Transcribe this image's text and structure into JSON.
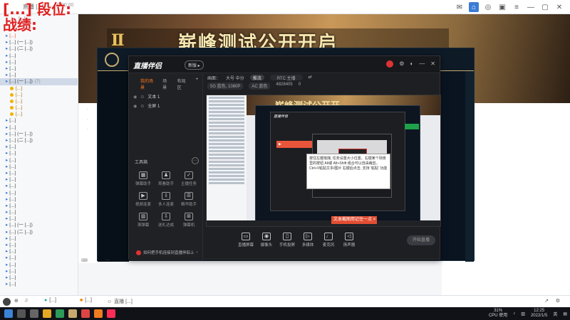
{
  "overlay": {
    "line1": "[...] 段位:",
    "line2": "战绩:"
  },
  "topbar": {
    "title": "直播 [...]",
    "time": "0:00:00"
  },
  "left_list": {
    "header": "[...]",
    "items": [
      {
        "label": "[...]",
        "count": "",
        "type": "red"
      },
      {
        "label": "[...] (一 [...])",
        "count": "",
        "type": "normal"
      },
      {
        "label": "[...] (二 [...])",
        "count": "",
        "type": "normal"
      },
      {
        "label": "[...]",
        "count": "",
        "type": "normal"
      },
      {
        "label": "[...]",
        "count": "",
        "type": "normal"
      },
      {
        "label": "[...]",
        "count": "",
        "type": "normal"
      },
      {
        "label": "[...]",
        "count": "",
        "type": "normal"
      },
      {
        "label": "[...] (一 [...])",
        "count": "(7)",
        "type": "sel"
      },
      {
        "label": "[...]",
        "count": "",
        "type": "sub"
      },
      {
        "label": "[...]",
        "count": "",
        "type": "sub"
      },
      {
        "label": "[...]",
        "count": "",
        "type": "sub"
      },
      {
        "label": "[...]",
        "count": "",
        "type": "sub"
      },
      {
        "label": "[...]",
        "count": "",
        "type": "sub"
      },
      {
        "label": "[...]",
        "count": "",
        "type": "normal"
      },
      {
        "label": "[...]",
        "count": "",
        "type": "normal"
      },
      {
        "label": "[...] (一 [...])",
        "count": "",
        "type": "normal"
      },
      {
        "label": "[...] (二 [...])",
        "count": "",
        "type": "normal"
      },
      {
        "label": "[...]",
        "count": "",
        "type": "normal"
      },
      {
        "label": "[...]",
        "count": "",
        "type": "normal"
      },
      {
        "label": "[...]",
        "count": "",
        "type": "normal"
      },
      {
        "label": "[...]",
        "count": "",
        "type": "normal"
      },
      {
        "label": "[...]",
        "count": "",
        "type": "normal"
      },
      {
        "label": "[...]",
        "count": "",
        "type": "normal"
      },
      {
        "label": "[...]",
        "count": "",
        "type": "normal"
      },
      {
        "label": "[...]",
        "count": "",
        "type": "normal"
      },
      {
        "label": "[...]",
        "count": "",
        "type": "normal"
      },
      {
        "label": "[...]",
        "count": "",
        "type": "normal"
      },
      {
        "label": "[...]",
        "count": "",
        "type": "normal"
      },
      {
        "label": "[...]",
        "count": "",
        "type": "normal"
      },
      {
        "label": "[...] (一 [...])",
        "count": "",
        "type": "normal"
      },
      {
        "label": "[...] (二 [...])",
        "count": "",
        "type": "normal"
      },
      {
        "label": "[...]",
        "count": "",
        "type": "normal"
      },
      {
        "label": "[...]",
        "count": "",
        "type": "normal"
      },
      {
        "label": "[...]",
        "count": "",
        "type": "normal"
      },
      {
        "label": "[...]",
        "count": "",
        "type": "normal"
      },
      {
        "label": "[...]",
        "count": "",
        "type": "normal"
      },
      {
        "label": "[...]",
        "count": "",
        "type": "normal"
      },
      {
        "label": "[...]",
        "count": "",
        "type": "normal"
      },
      {
        "label": "[...]",
        "count": "",
        "type": "normal"
      }
    ]
  },
  "banner": {
    "text": "崭峰测试公开开启"
  },
  "obs": {
    "brand": "直播伴侣",
    "tag": "新版 ▸",
    "tabs": [
      "我的场景",
      "场景",
      "布局区"
    ],
    "sources": [
      "文本 1",
      "全屏 1"
    ],
    "toolbox_title": "工具箱",
    "tools": [
      "弹幕助手",
      "观看助手",
      "主播任务",
      "视频连麦",
      "多人连麦",
      "精华助手",
      "滚弹幕",
      "送礼达成",
      "弹幕机"
    ],
    "option_text": "如何把手机连接到直播伴侣上",
    "bar1": [
      "画面：",
      "大号 中分",
      "推流",
      "RTC 主播",
      "⇄"
    ],
    "bar2": [
      "5G 蓝色, 1080P",
      "AC 蓝色",
      "4828405",
      "0"
    ],
    "preview_banner": "崭峰测试公开开",
    "red_hint": "文本截图用记住一点 ×",
    "tip": "按住左键拖拽, 任务设置大小位置。右键某个场景里的按钮 Alt或 Alt+Shift 组合可以自由裁剪。 Ctrl+V粘贴文本/图片 右键后点击, 支持 '粘贴' 功能",
    "controls": [
      "直播屏幕",
      "摄像头",
      "手机投屏",
      "多媒体",
      "麦克风",
      "扬声器"
    ],
    "start": "开始直播"
  },
  "bottombar": {
    "left": "[...]",
    "mid": "[...]",
    "live": "直播 [...]"
  },
  "taskbar": {
    "cpu": "31%",
    "cpu_label": "CPU 使用",
    "time": "12:25",
    "date": "2022/1/5",
    "lang": "英"
  }
}
